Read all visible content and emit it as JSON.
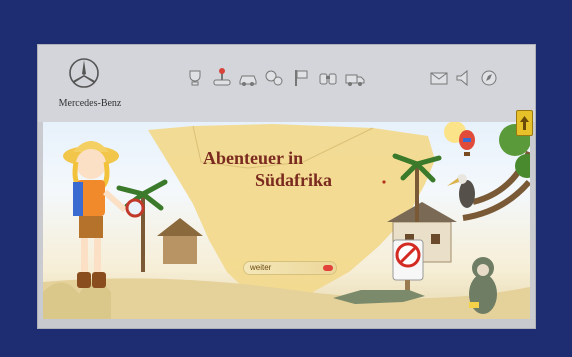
{
  "header": {
    "brand": "Mercedes-Benz",
    "toolbar_icons": [
      "trophy-icon",
      "joystick-icon",
      "car-icon",
      "gears-icon",
      "flag-icon",
      "binoculars-icon",
      "truck-icon"
    ],
    "utility_icons": [
      "envelope-icon",
      "speaker-icon",
      "compass-icon"
    ]
  },
  "scene": {
    "title_line1": "Abenteuer in",
    "title_line2": "Südafrika",
    "continue_label": "weiter"
  },
  "colors": {
    "outer_background": "#1e2d72",
    "title": "#7a2a1e",
    "map": "#f2d98e",
    "accent_red": "#e2423a",
    "scroll_button": "#e7c12a"
  }
}
